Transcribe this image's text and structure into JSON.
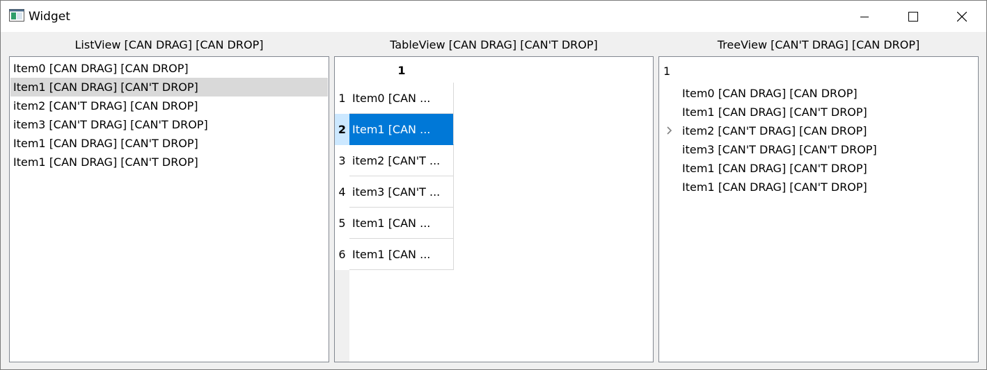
{
  "window": {
    "title": "Widget",
    "icon": "app-icon"
  },
  "titlebar_buttons": [
    "minimize-icon",
    "maximize-icon",
    "close-icon"
  ],
  "list_view": {
    "caption": "ListView [CAN DRAG]  [CAN DROP]",
    "items": [
      {
        "label": "Item0 [CAN DRAG] [CAN DROP]",
        "selected": false
      },
      {
        "label": "Item1 [CAN DRAG] [CAN'T DROP]",
        "selected": true
      },
      {
        "label": "item2 [CAN'T DRAG] [CAN DROP]",
        "selected": false
      },
      {
        "label": "item3 [CAN'T DRAG] [CAN'T DROP]",
        "selected": false
      },
      {
        "label": "Item1 [CAN DRAG] [CAN'T DROP]",
        "selected": false
      },
      {
        "label": "Item1 [CAN DRAG] [CAN'T DROP]",
        "selected": false
      }
    ]
  },
  "table_view": {
    "caption": "TableView [CAN DRAG]  [CAN'T DROP]",
    "column_header": "1",
    "rows": [
      {
        "header": "1",
        "cell": "Item0 [CAN ...",
        "selected": false
      },
      {
        "header": "2",
        "cell": "Item1 [CAN ...",
        "selected": true
      },
      {
        "header": "3",
        "cell": "item2 [CAN'T ...",
        "selected": false
      },
      {
        "header": "4",
        "cell": "item3 [CAN'T ...",
        "selected": false
      },
      {
        "header": "5",
        "cell": "Item1 [CAN ...",
        "selected": false
      },
      {
        "header": "6",
        "cell": "Item1 [CAN ...",
        "selected": false
      }
    ]
  },
  "tree_view": {
    "caption": "TreeView [CAN'T DRAG]  [CAN DROP]",
    "header": "1",
    "items": [
      {
        "label": "Item0 [CAN DRAG] [CAN DROP]",
        "has_children": false
      },
      {
        "label": "Item1 [CAN DRAG] [CAN'T DROP]",
        "has_children": false
      },
      {
        "label": "item2 [CAN'T DRAG] [CAN DROP]",
        "has_children": true
      },
      {
        "label": "item3 [CAN'T DRAG] [CAN'T DROP]",
        "has_children": false
      },
      {
        "label": "Item1 [CAN DRAG] [CAN'T DROP]",
        "has_children": false
      },
      {
        "label": "Item1 [CAN DRAG] [CAN'T DROP]",
        "has_children": false
      }
    ]
  },
  "colors": {
    "selection": "#0078d7",
    "list_selection": "#d9d9d9",
    "row_header_current": "#cce8ff"
  }
}
